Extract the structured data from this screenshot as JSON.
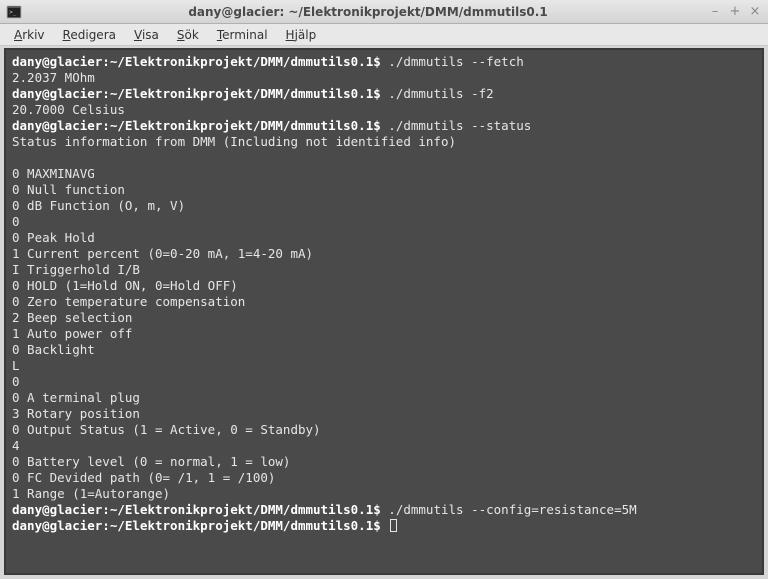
{
  "window": {
    "title": "dany@glacier: ~/Elektronikprojekt/DMM/dmmutils0.1"
  },
  "menu": {
    "items": [
      {
        "label": "Arkiv",
        "ul": "A",
        "rest": "rkiv"
      },
      {
        "label": "Redigera",
        "ul": "R",
        "rest": "edigera"
      },
      {
        "label": "Visa",
        "ul": "V",
        "rest": "isa"
      },
      {
        "label": "Sök",
        "ul": "S",
        "rest": "ök"
      },
      {
        "label": "Terminal",
        "ul": "T",
        "rest": "erminal"
      },
      {
        "label": "Hjälp",
        "ul": "H",
        "rest": "jälp"
      }
    ]
  },
  "terminal": {
    "prompt": "dany@glacier:~/Elektronikprojekt/DMM/dmmutils0.1$ ",
    "lines": [
      {
        "type": "cmd",
        "text": "./dmmutils --fetch"
      },
      {
        "type": "out",
        "text": "2.2037 MOhm"
      },
      {
        "type": "cmd",
        "text": "./dmmutils -f2"
      },
      {
        "type": "out",
        "text": "20.7000 Celsius"
      },
      {
        "type": "cmd",
        "text": "./dmmutils --status"
      },
      {
        "type": "out",
        "text": "Status information from DMM (Including not identified info)"
      },
      {
        "type": "out",
        "text": ""
      },
      {
        "type": "out",
        "text": "0 MAXMINAVG"
      },
      {
        "type": "out",
        "text": "0 Null function"
      },
      {
        "type": "out",
        "text": "0 dB Function (O, m, V)"
      },
      {
        "type": "out",
        "text": "0"
      },
      {
        "type": "out",
        "text": "0 Peak Hold"
      },
      {
        "type": "out",
        "text": "1 Current percent (0=0-20 mA, 1=4-20 mA)"
      },
      {
        "type": "out",
        "text": "I Triggerhold I/B"
      },
      {
        "type": "out",
        "text": "0 HOLD (1=Hold ON, 0=Hold OFF)"
      },
      {
        "type": "out",
        "text": "0 Zero temperature compensation"
      },
      {
        "type": "out",
        "text": "2 Beep selection"
      },
      {
        "type": "out",
        "text": "1 Auto power off"
      },
      {
        "type": "out",
        "text": "0 Backlight"
      },
      {
        "type": "out",
        "text": "L"
      },
      {
        "type": "out",
        "text": "0"
      },
      {
        "type": "out",
        "text": "0 A terminal plug"
      },
      {
        "type": "out",
        "text": "3 Rotary position"
      },
      {
        "type": "out",
        "text": "0 Output Status (1 = Active, 0 = Standby)"
      },
      {
        "type": "out",
        "text": "4"
      },
      {
        "type": "out",
        "text": "0 Battery level (0 = normal, 1 = low)"
      },
      {
        "type": "out",
        "text": "0 FC Devided path (0= /1, 1 = /100)"
      },
      {
        "type": "out",
        "text": "1 Range (1=Autorange)"
      },
      {
        "type": "cmd",
        "text": "./dmmutils --config=resistance=5M"
      },
      {
        "type": "prompt-only"
      }
    ]
  }
}
